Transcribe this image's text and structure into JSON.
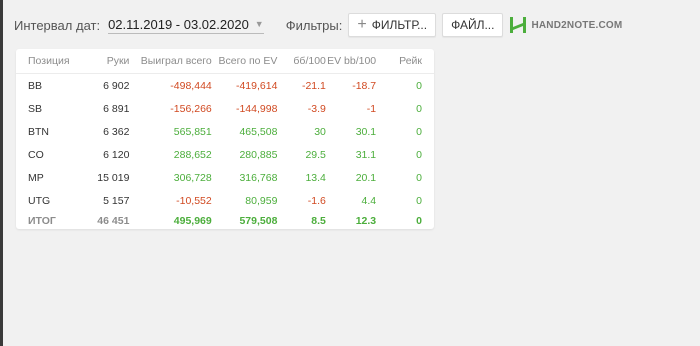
{
  "toolbar": {
    "interval_label": "Интервал дат:",
    "date_range": "02.11.2019 - 03.02.2020",
    "filters_label": "Фильтры:",
    "filter_button": "ФИЛЬТР...",
    "files_button": "ФАЙЛ...",
    "logo_text": "HAND2NOTE.COM",
    "logo_color": "#4cae3c"
  },
  "table": {
    "headers": [
      "Позиция",
      "Руки",
      "Выиграл всего",
      "Всего по EV",
      "бб/100",
      "EV bb/100",
      "Рейк"
    ],
    "rows": [
      {
        "pos": "BB",
        "hands": "6 902",
        "won": "-498,444",
        "ev": "-419,614",
        "bb": "-21.1",
        "evbb": "-18.7",
        "rake": "0"
      },
      {
        "pos": "SB",
        "hands": "6 891",
        "won": "-156,266",
        "ev": "-144,998",
        "bb": "-3.9",
        "evbb": "-1",
        "rake": "0"
      },
      {
        "pos": "BTN",
        "hands": "6 362",
        "won": "565,851",
        "ev": "465,508",
        "bb": "30",
        "evbb": "30.1",
        "rake": "0"
      },
      {
        "pos": "CO",
        "hands": "6 120",
        "won": "288,652",
        "ev": "280,885",
        "bb": "29.5",
        "evbb": "31.1",
        "rake": "0"
      },
      {
        "pos": "MP",
        "hands": "15 019",
        "won": "306,728",
        "ev": "316,768",
        "bb": "13.4",
        "evbb": "20.1",
        "rake": "0"
      },
      {
        "pos": "UTG",
        "hands": "5 157",
        "won": "-10,552",
        "ev": "80,959",
        "bb": "-1.6",
        "evbb": "4.4",
        "rake": "0"
      }
    ],
    "total": {
      "pos": "ИТОГ",
      "hands": "46 451",
      "won": "495,969",
      "ev": "579,508",
      "bb": "8.5",
      "evbb": "12.3",
      "rake": "0"
    },
    "colors": {
      "negative": "#d14a22",
      "positive": "#4cae3c"
    }
  }
}
